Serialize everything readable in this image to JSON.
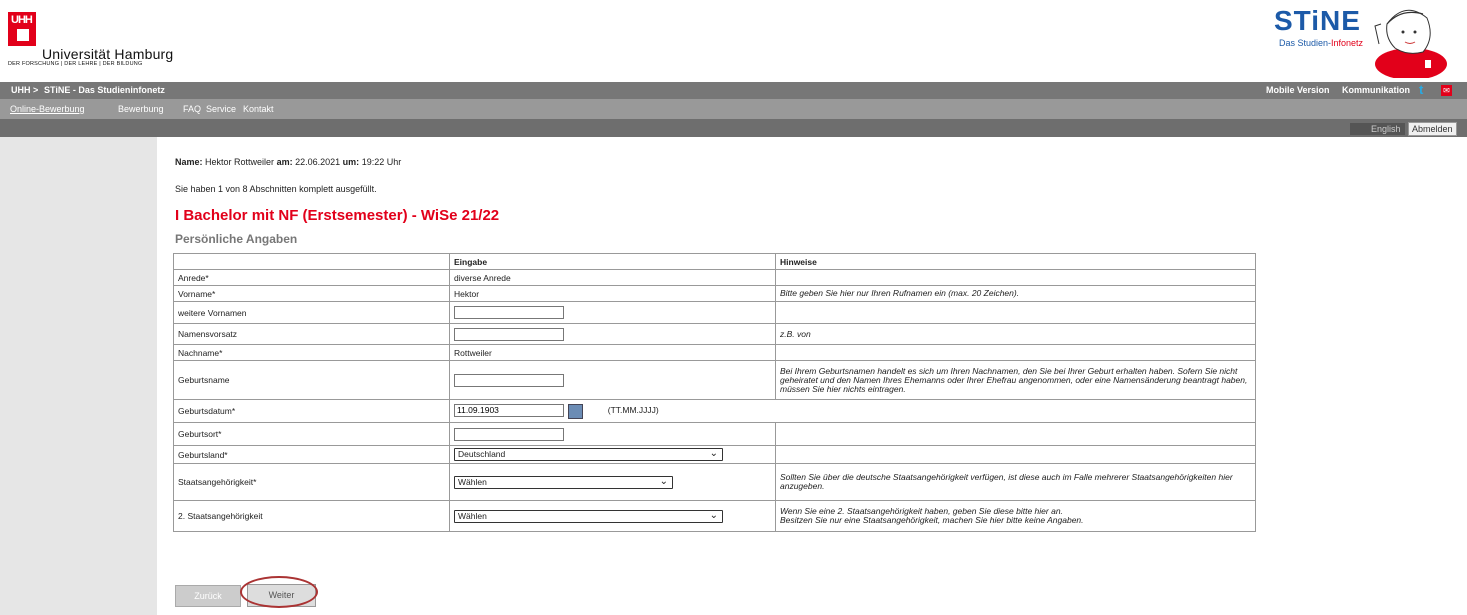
{
  "header": {
    "logo_mark": "UHH",
    "university": "Universität Hamburg",
    "tagline": "DER FORSCHUNG | DER LEHRE | DER BILDUNG",
    "stine_logo": "STiNE",
    "stine_sub_left": "Das Studien-",
    "stine_sub_right": "Infonetz"
  },
  "topbar": {
    "crumb1": "UHH >",
    "crumb2": "STiNE - Das Studieninfonetz",
    "mobile": "Mobile Version",
    "kommunikation": "Kommunikation",
    "icons": [
      "twitter-icon",
      "mail-icon"
    ]
  },
  "nav": {
    "tabs": [
      "Online-Bewerbung",
      "Bewerbung",
      "FAQ",
      "Service",
      "Kontakt"
    ]
  },
  "utility": {
    "english": "English",
    "logout": "Abmelden"
  },
  "user": {
    "name_label": "Name:",
    "name": "Hektor Rottweiler",
    "am_label": "am:",
    "date": "22.06.2021",
    "um_label": "um:",
    "time": "19:22 Uhr"
  },
  "progress_text": "Sie haben 1 von 8 Abschnitten komplett ausgefüllt.",
  "heading": "I Bachelor mit NF (Erstsemester) - WiSe 21/22",
  "subheading": "Persönliche Angaben",
  "table": {
    "headers": [
      "",
      "Eingabe",
      "Hinweise"
    ],
    "rows": {
      "anrede": {
        "label": "Anrede*",
        "value": "diverse Anrede"
      },
      "vorname": {
        "label": "Vorname*",
        "value": "Hektor",
        "hint": "Bitte geben Sie hier nur Ihren Rufnamen ein (max. 20 Zeichen)."
      },
      "weitere": {
        "label": "weitere Vornamen",
        "value": ""
      },
      "namensvorsatz": {
        "label": "Namensvorsatz",
        "value": "",
        "hint": "z.B. von"
      },
      "nachname": {
        "label": "Nachname*",
        "value": "Rottweiler"
      },
      "geburtsname": {
        "label": "Geburtsname",
        "value": "",
        "hint": "Bei Ihrem Geburtsnamen handelt es sich um Ihren Nachnamen, den Sie bei Ihrer Geburt erhalten haben. Sofern Sie nicht geheiratet und den Namen Ihres Ehemanns oder Ihrer Ehefrau angenommen, oder eine Namensänderung beantragt haben, müssen Sie hier nichts eintragen."
      },
      "geburtsdatum": {
        "label": "Geburtsdatum*",
        "value": "11.09.1903",
        "format": "(TT.MM.JJJJ)"
      },
      "geburtsort": {
        "label": "Geburtsort*",
        "value": ""
      },
      "geburtsland": {
        "label": "Geburtsland*",
        "value": "Deutschland"
      },
      "staatsang": {
        "label": "Staatsangehörigkeit*",
        "value": "Wählen",
        "hint": "Sollten Sie über die deutsche Staatsangehörigkeit verfügen, ist diese auch im Falle mehrerer Staatsangehörigkeiten hier anzugeben."
      },
      "staatsang2": {
        "label": "2. Staatsangehörigkeit",
        "value": "Wählen",
        "hint1": "Wenn Sie eine 2. Staatsangehörigkeit haben, geben Sie diese bitte hier an.",
        "hint2": "Besitzen Sie nur eine Staatsangehörigkeit, machen Sie hier bitte keine Angaben."
      }
    }
  },
  "buttons": {
    "back": "Zurück",
    "next": "Weiter"
  },
  "colors": {
    "accent_red": "#e2001a",
    "stine_blue": "#1c5aa8",
    "bar_dark": "#777777",
    "bar_mid": "#999999"
  }
}
